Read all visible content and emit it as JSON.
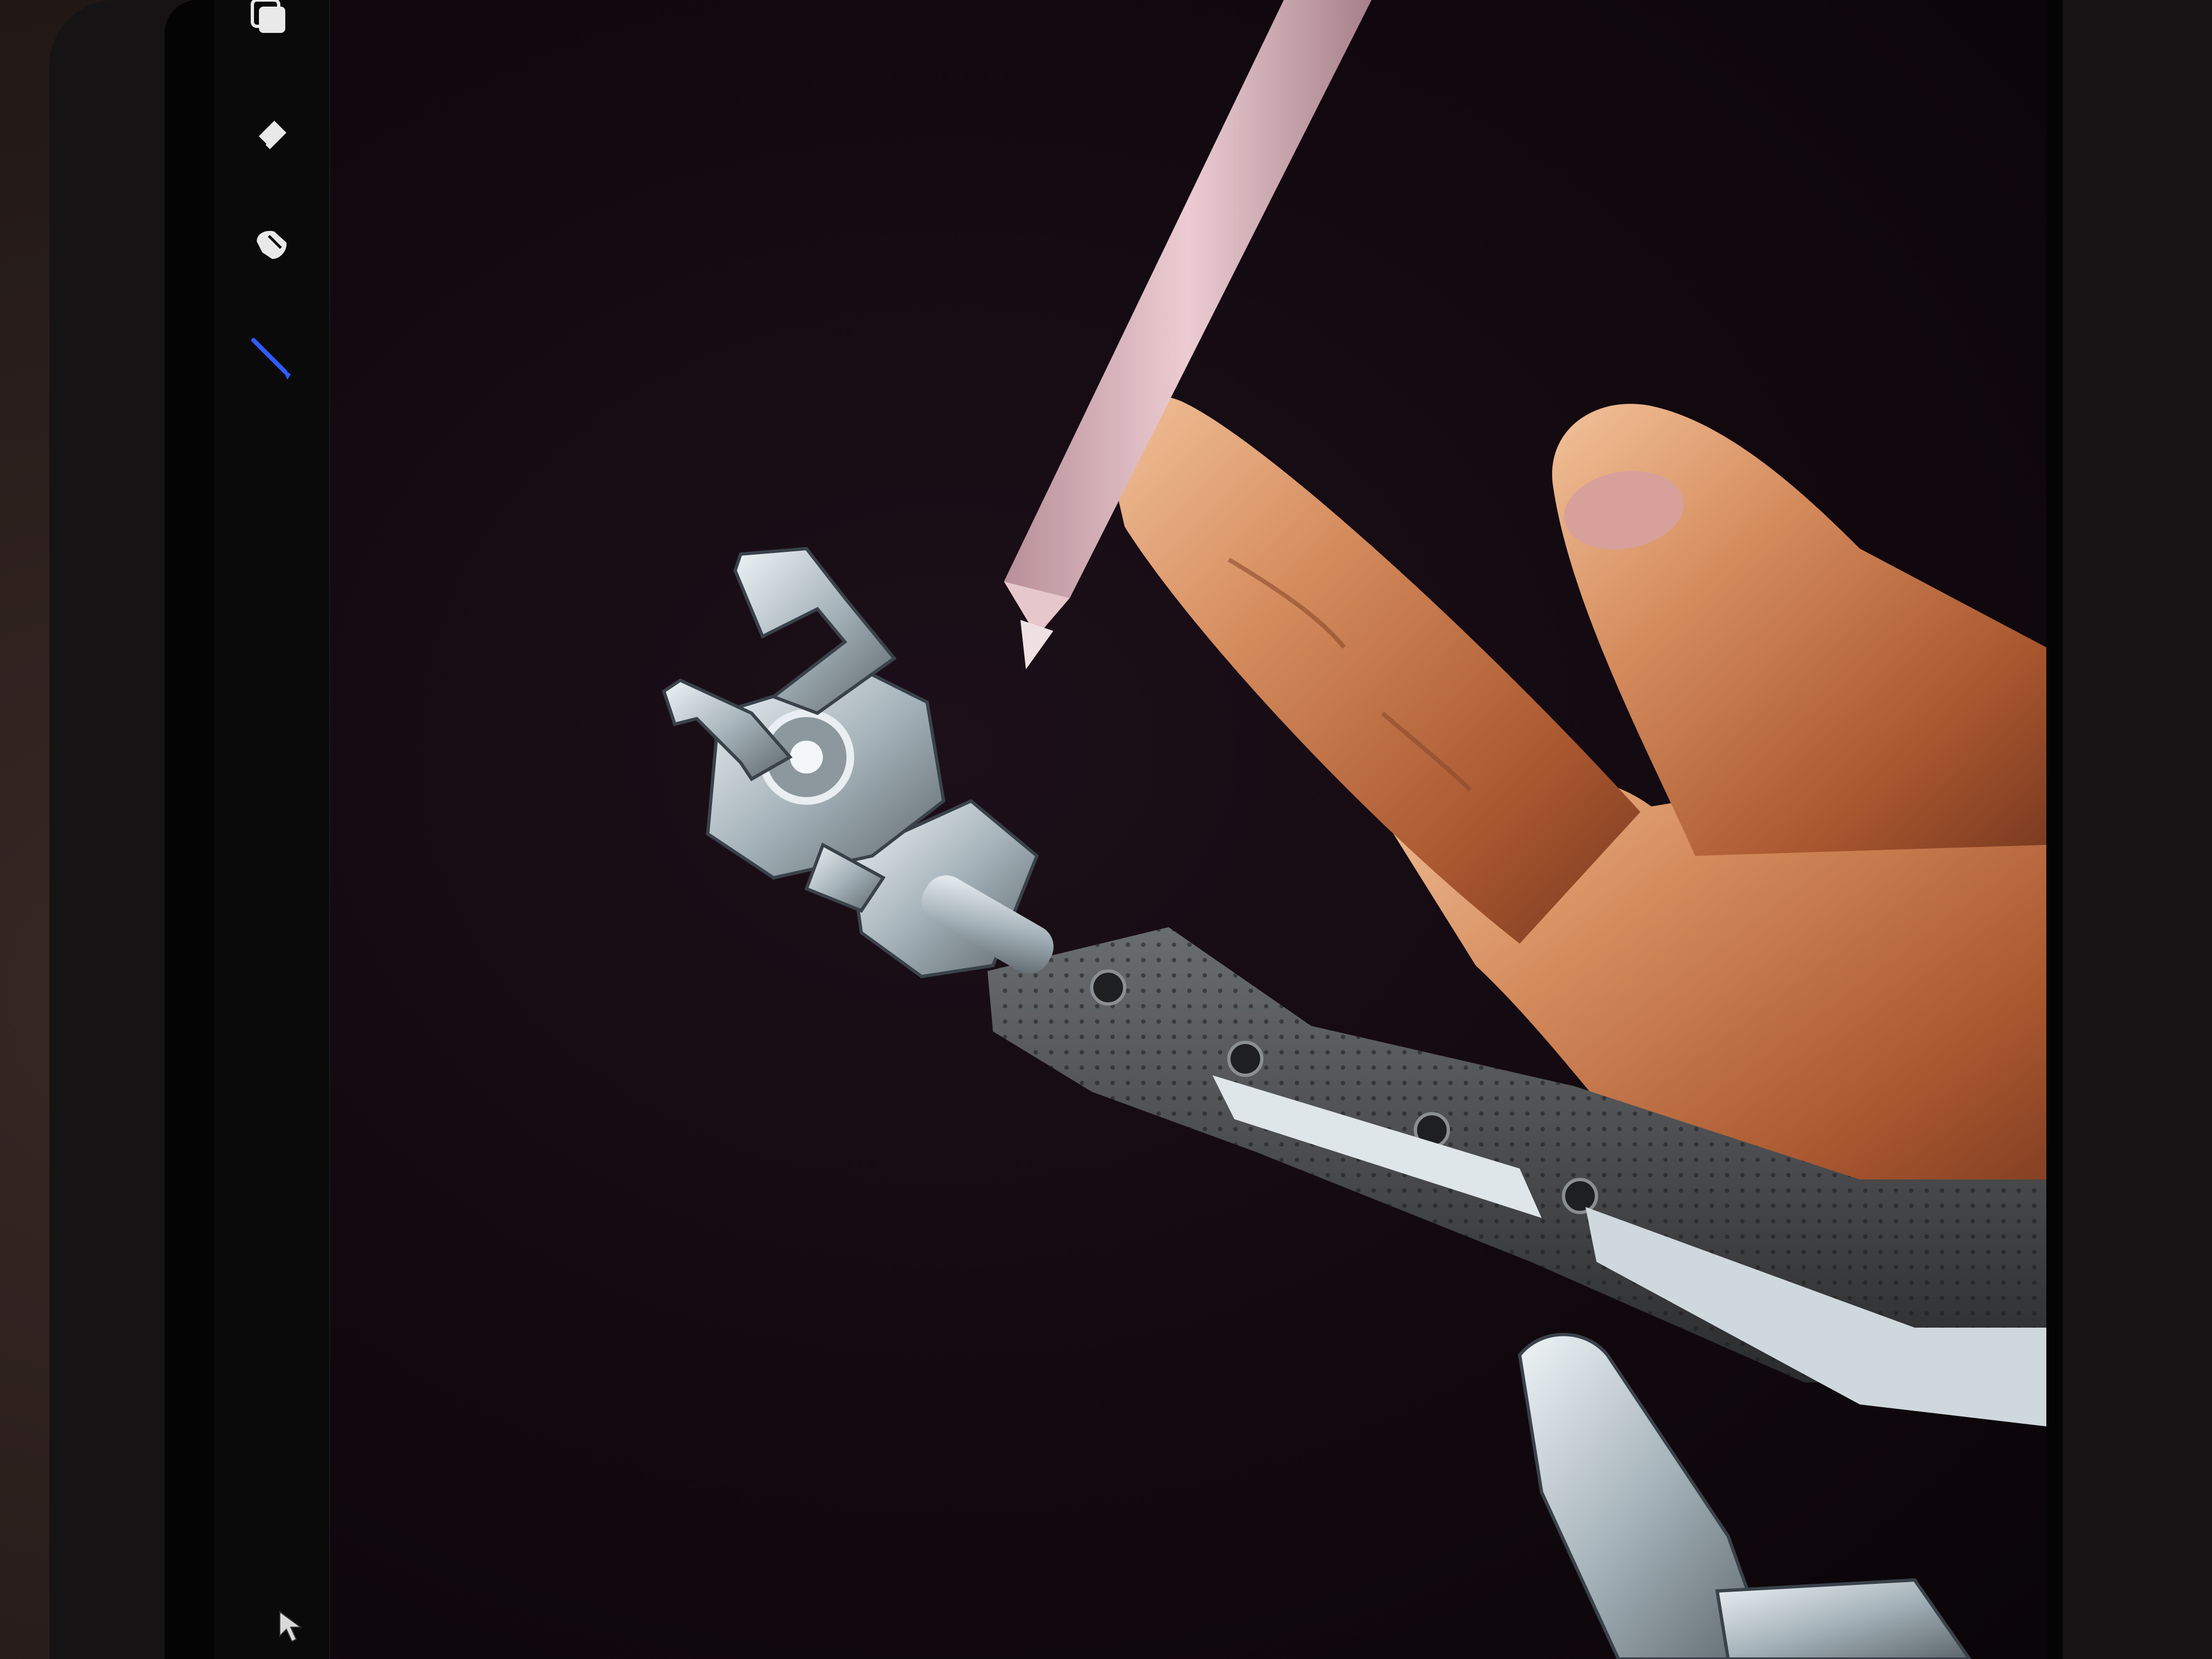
{
  "scene": {
    "colors": {
      "canvas_background": "#12090f",
      "sidebar_background": "#0b0a0b",
      "active_tool": "#2f5bff",
      "tool_icon": "#e9e9ea",
      "pencil_body": "#d9b3bb",
      "skin": "#c9825a",
      "metal": "#b9c3c8"
    }
  },
  "toolbar": {
    "tools": [
      {
        "icon": "layers-icon",
        "active": false
      },
      {
        "icon": "eraser-icon",
        "active": false
      },
      {
        "icon": "smudge-icon",
        "active": false
      },
      {
        "icon": "brush-icon",
        "active": true
      }
    ]
  },
  "canvas": {
    "subject": [
      "human-hand",
      "robotic-arm",
      "stylus-pencil"
    ]
  },
  "pointer": {
    "icon": "arrow-cursor-icon"
  }
}
